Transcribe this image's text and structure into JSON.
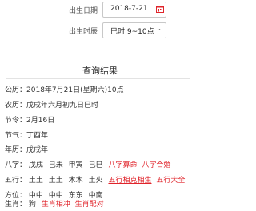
{
  "form": {
    "birth_date_label": "出生日期",
    "birth_date_value": "2018-7-21",
    "birth_time_label": "出生时辰",
    "birth_time_value": "巳时 9~10点"
  },
  "result": {
    "title": "查询结果",
    "gongli": {
      "label": "公历：",
      "value": "2018年7月21日(星期六)10点"
    },
    "nongli": {
      "label": "农历：",
      "value": "戊戌年六月初九日巳时"
    },
    "jieqi": {
      "label": "节令：",
      "value": "2月16日"
    },
    "jieqi2": {
      "label": "节气：",
      "value": "丁酉年"
    },
    "shengxiao_year": {
      "label": "年历：",
      "value": "戊戌年"
    },
    "bazi": {
      "label": "八字：",
      "cells": [
        "戊戌",
        "己未",
        "甲寅",
        "己巳"
      ],
      "links": [
        "八字算命",
        "八字合婚"
      ]
    },
    "wuxing": {
      "label": "五行：",
      "cells": [
        "土土",
        "土土",
        "木木",
        "土火"
      ],
      "links": [
        "五行相克相生",
        "五行大全"
      ]
    },
    "fangwei": {
      "label": "方位：",
      "cells": [
        "中中",
        "中中",
        "东东",
        "中南"
      ]
    },
    "shengxiao": {
      "label": "生肖：",
      "cells": [
        "狗"
      ],
      "links": [
        "生肖相冲",
        "生肖配对"
      ]
    }
  },
  "colors": {
    "link": "#e0242b",
    "text": "#333333",
    "border": "#c8c8c8"
  }
}
